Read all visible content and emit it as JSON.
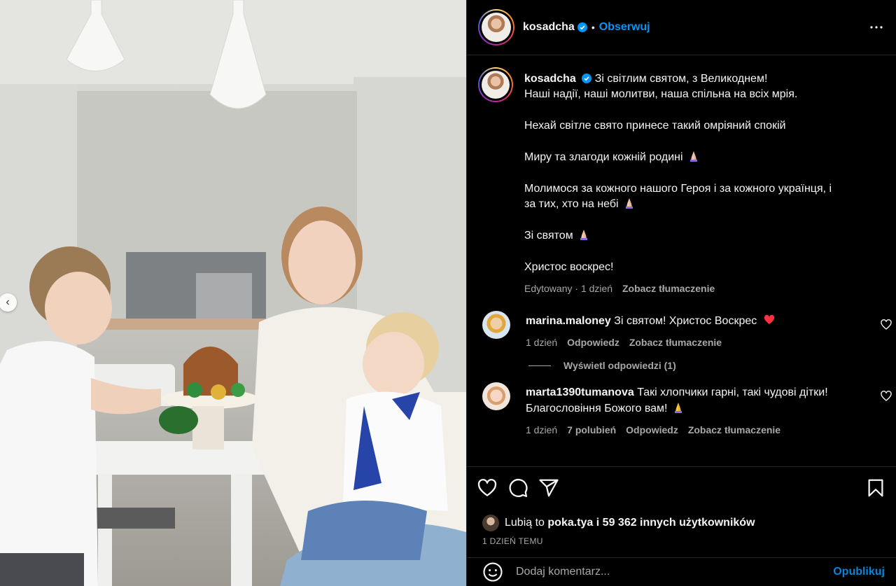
{
  "post": {
    "username": "kosadcha",
    "follow_label": "Obserwuj",
    "separator": "•"
  },
  "caption": {
    "username": "kosadcha",
    "lines": [
      "Зі світлим святом, з Великоднем!",
      "Наші надії, наші молитви, наша спільна на всіх мрія.",
      "",
      "Нехай світле свято принесе такий омріяний спокій",
      "",
      "Миру та злагоди кожній родині",
      "",
      "Молимося за кожного нашого Героя і за кожного українця, і",
      "за тих, хто на небі",
      "",
      "Зі святом",
      "",
      "Христос воскрес!"
    ],
    "edited": "Edytowany",
    "time": "1 dzień",
    "translate": "Zobacz tłumaczenie"
  },
  "comments": [
    {
      "username": "marina.maloney",
      "text": "Зі святом! Христос Воскрес",
      "time": "1 dzień",
      "reply": "Odpowiedz",
      "translate": "Zobacz tłumaczenie",
      "replies_label": "Wyświetl odpowiedzi (1)"
    },
    {
      "username": "marta1390tumanova",
      "text_line1": "Такі хлопчики гарні, такі чудові дітки!",
      "text_line2": "Благословіння Божого вам!",
      "time": "1 dzień",
      "likes": "7 polubień",
      "reply": "Odpowiedz",
      "translate": "Zobacz tłumaczenie"
    }
  ],
  "likes": {
    "prefix": "Lubią to",
    "user": "poka.tya",
    "connector": "i",
    "others": "59 362 innych użytkowników"
  },
  "timestamp": "1 DZIEŃ TEMU",
  "comment_input": {
    "placeholder": "Dodaj komentarz...",
    "publish": "Opublikuj"
  },
  "colors": {
    "accent": "#0095f6",
    "background": "#000000",
    "muted": "#a8a8a8",
    "heart_red": "#ff3040"
  },
  "icons": [
    "verified-icon",
    "more-icon",
    "heart-icon",
    "comment-icon",
    "share-icon",
    "bookmark-icon",
    "emoji-icon",
    "praying-hands-icon",
    "chevron-left-icon"
  ]
}
